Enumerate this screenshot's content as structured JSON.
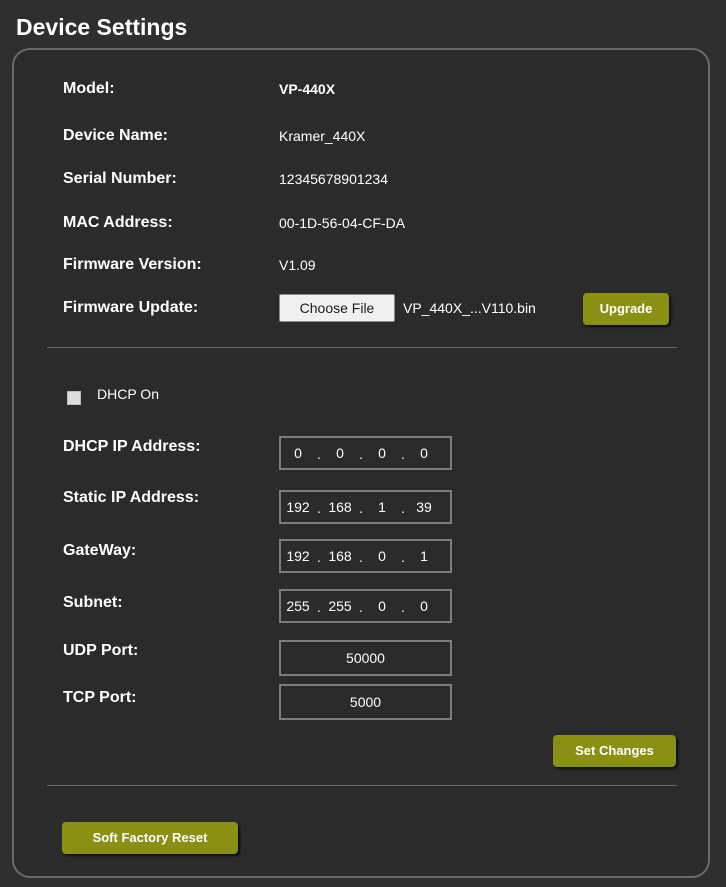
{
  "page_title": "Device Settings",
  "info": {
    "model_label": "Model:",
    "model_value": "VP-440X",
    "device_name_label": "Device Name:",
    "device_name_value": "Kramer_440X",
    "serial_label": "Serial Number:",
    "serial_value": "12345678901234",
    "mac_label": "MAC Address:",
    "mac_value": "00-1D-56-04-CF-DA",
    "firmware_version_label": "Firmware Version:",
    "firmware_version_value": "V1.09",
    "firmware_update_label": "Firmware Update:",
    "choose_file_label": "Choose File",
    "selected_file": "VP_440X_...V110.bin",
    "upgrade_label": "Upgrade"
  },
  "network": {
    "dhcp_label": "DHCP On",
    "dhcp_checked": false,
    "dhcp_ip_label": "DHCP IP Address:",
    "dhcp_ip": [
      "0",
      "0",
      "0",
      "0"
    ],
    "static_ip_label": "Static IP Address:",
    "static_ip": [
      "192",
      "168",
      "1",
      "39"
    ],
    "gateway_label": "GateWay:",
    "gateway": [
      "192",
      "168",
      "0",
      "1"
    ],
    "subnet_label": "Subnet:",
    "subnet": [
      "255",
      "255",
      "0",
      "0"
    ],
    "udp_label": "UDP Port:",
    "udp_value": "50000",
    "tcp_label": "TCP Port:",
    "tcp_value": "5000",
    "ip_separator": ".",
    "set_changes_label": "Set Changes"
  },
  "reset": {
    "soft_factory_reset_label": "Soft Factory Reset"
  },
  "colors": {
    "background": "#2f2f2f",
    "panel_border": "#6a6a6a",
    "accent_button": "#8a9013",
    "text": "#ffffff"
  }
}
